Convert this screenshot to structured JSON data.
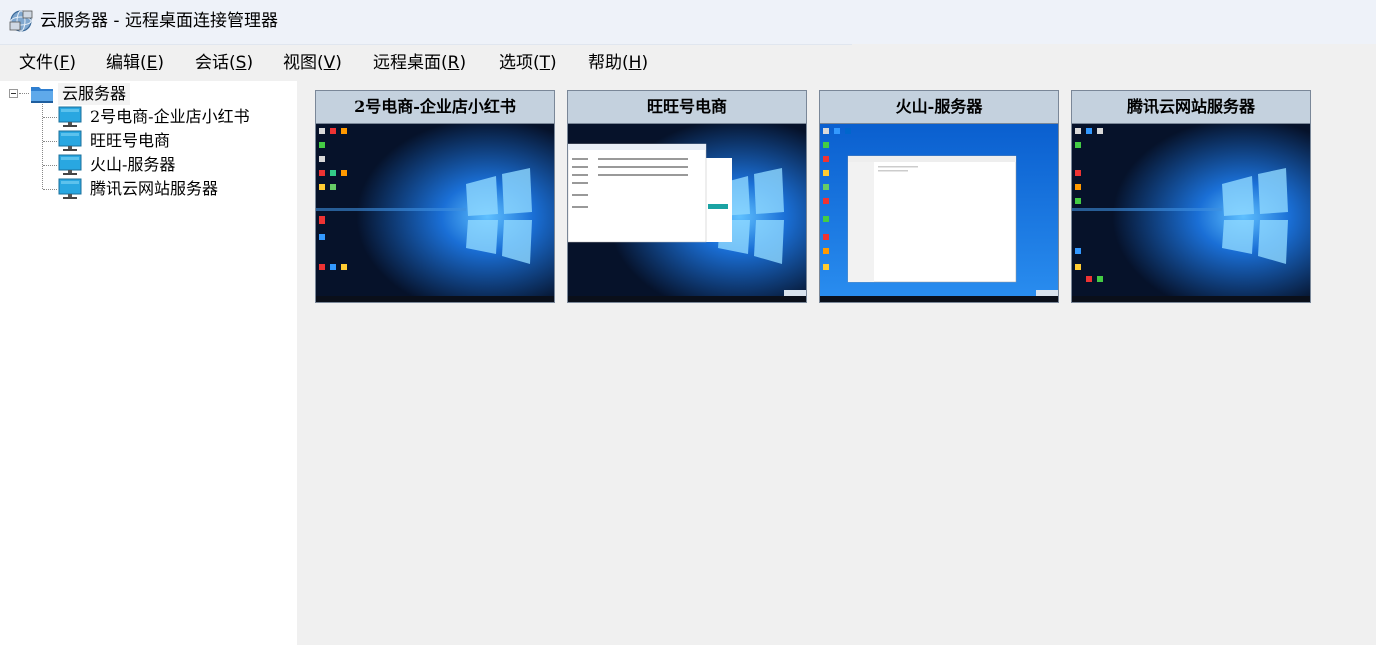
{
  "window": {
    "title": "云服务器 - 远程桌面连接管理器"
  },
  "menu": [
    {
      "label": "文件(",
      "key": "F",
      "end": ")"
    },
    {
      "label": "编辑(",
      "key": "E",
      "end": ")"
    },
    {
      "label": "会话(",
      "key": "S",
      "end": ")"
    },
    {
      "label": "视图(",
      "key": "V",
      "end": ")"
    },
    {
      "label": "远程桌面(",
      "key": "R",
      "end": ")"
    },
    {
      "label": "选项(",
      "key": "T",
      "end": ")"
    },
    {
      "label": "帮助(",
      "key": "H",
      "end": ")"
    }
  ],
  "tree": {
    "root": "云服务器",
    "servers": [
      "2号电商-企业店小红书",
      "旺旺号电商",
      "火山-服务器",
      "腾讯云网站服务器"
    ]
  },
  "thumbnails": [
    {
      "title": "2号电商-企业店小红书",
      "state": "desktop"
    },
    {
      "title": "旺旺号电商",
      "state": "explorer-window"
    },
    {
      "title": "火山-服务器",
      "state": "editor-window"
    },
    {
      "title": "腾讯云网站服务器",
      "state": "desktop"
    }
  ],
  "colors": {
    "titlebar": "#eef2f9",
    "thumb_header": "#c4d1de",
    "desktop_blue": "#1a6fd6",
    "monitor_icon": "#2aa0d8"
  }
}
